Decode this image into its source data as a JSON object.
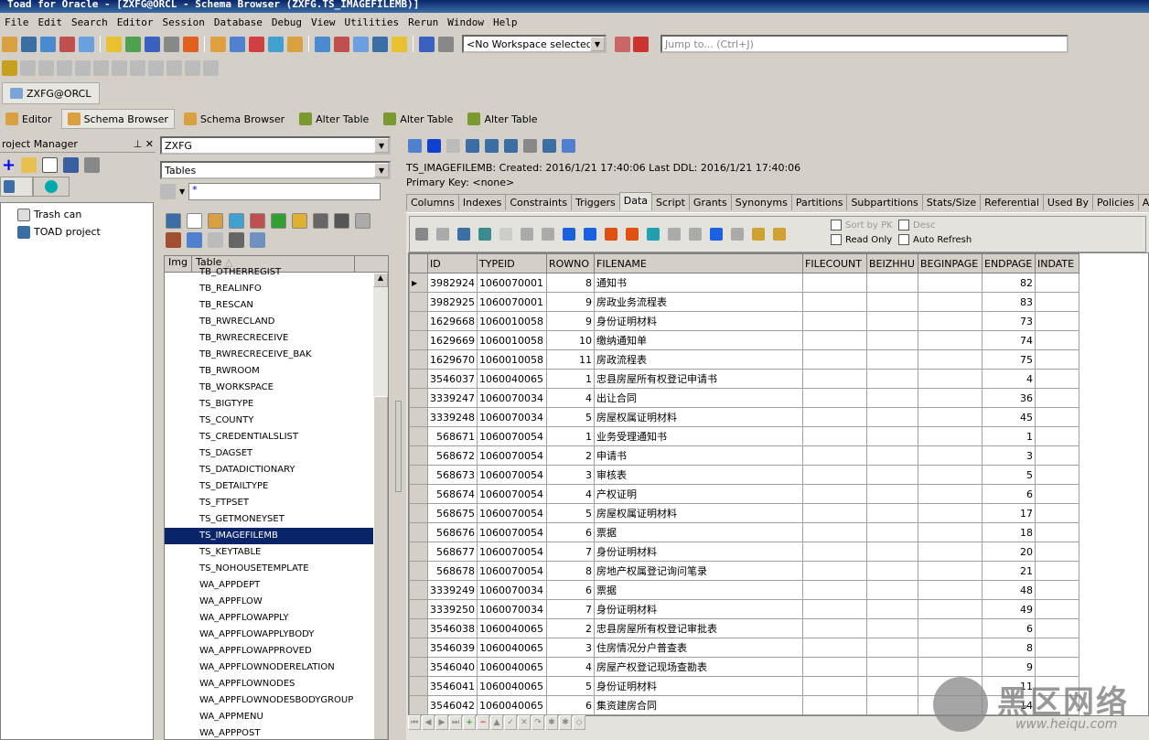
{
  "window": {
    "title": "Toad for Oracle - [ZXFG@ORCL - Schema Browser (ZXFG.TS_IMAGEFILEMB)]"
  },
  "menu": [
    "File",
    "Edit",
    "Search",
    "Editor",
    "Session",
    "Database",
    "Debug",
    "View",
    "Utilities",
    "Rerun",
    "Window",
    "Help"
  ],
  "toolbar": {
    "workspace": "<No Workspace selected>",
    "jump_placeholder": "Jump to... (Ctrl+J)"
  },
  "connection_tab": "ZXFG@ORCL",
  "window_tabs": [
    "Editor",
    "Schema Browser",
    "Schema Browser",
    "Alter Table",
    "Alter Table",
    "Alter Table"
  ],
  "project_manager": {
    "title": "roject Manager",
    "tree": [
      "Trash can",
      "TOAD project"
    ]
  },
  "schema": {
    "owner": "ZXFG",
    "object_type": "Tables",
    "filter": "*",
    "list_headers": [
      "Img",
      "Table"
    ],
    "tables": [
      "TB_OTHERREGIST",
      "TB_REALINFO",
      "TB_RESCAN",
      "TB_RWRECLAND",
      "TB_RWRECRECEIVE",
      "TB_RWRECRECEIVE_BAK",
      "TB_RWROOM",
      "TB_WORKSPACE",
      "TS_BIGTYPE",
      "TS_COUNTY",
      "TS_CREDENTIALSLIST",
      "TS_DAGSET",
      "TS_DATADICTIONARY",
      "TS_DETAILTYPE",
      "TS_FTPSET",
      "TS_GETMONEYSET",
      "TS_IMAGEFILEMB",
      "TS_KEYTABLE",
      "TS_NOHOUSETEMPLATE",
      "WA_APPDEPT",
      "WA_APPFLOW",
      "WA_APPFLOWAPPLY",
      "WA_APPFLOWAPPLYBODY",
      "WA_APPFLOWAPPROVED",
      "WA_APPFLOWNODERELATION",
      "WA_APPFLOWNODES",
      "WA_APPFLOWNODESBODYGROUP",
      "WA_APPMENU",
      "WA_APPPOST"
    ],
    "selected": "TS_IMAGEFILEMB"
  },
  "detail": {
    "info": "TS_IMAGEFILEMB:  Created: 2016/1/21 17:40:06   Last DDL: 2016/1/21 17:40:06",
    "primary_key": "Primary Key:  <none>",
    "tabs": [
      "Columns",
      "Indexes",
      "Constraints",
      "Triggers",
      "Data",
      "Script",
      "Grants",
      "Synonyms",
      "Partitions",
      "Subpartitions",
      "Stats/Size",
      "Referential",
      "Used By",
      "Policies",
      "Auditing"
    ],
    "active_tab": "Data",
    "options": {
      "sort_by_pk": "Sort by PK",
      "desc": "Desc",
      "read_only": "Read Only",
      "auto_refresh": "Auto Refresh"
    }
  },
  "grid": {
    "columns": [
      "ID",
      "TYPEID",
      "ROWNO",
      "FILENAME",
      "FILECOUNT",
      "BEIZHHU",
      "BEGINPAGE",
      "ENDPAGE",
      "INDATE"
    ],
    "rows": [
      [
        "3982924",
        "1060070001",
        "8",
        "通知书",
        "",
        "",
        "",
        "82",
        ""
      ],
      [
        "3982925",
        "1060070001",
        "9",
        "房政业务流程表",
        "",
        "",
        "",
        "83",
        ""
      ],
      [
        "1629668",
        "1060010058",
        "9",
        "身份证明材料",
        "",
        "",
        "",
        "73",
        ""
      ],
      [
        "1629669",
        "1060010058",
        "10",
        "缴纳通知单",
        "",
        "",
        "",
        "74",
        ""
      ],
      [
        "1629670",
        "1060010058",
        "11",
        "房政流程表",
        "",
        "",
        "",
        "75",
        ""
      ],
      [
        "3546037",
        "1060040065",
        "1",
        "忠县房屋所有权登记申请书",
        "",
        "",
        "",
        "4",
        ""
      ],
      [
        "3339247",
        "1060070034",
        "4",
        "出让合同",
        "",
        "",
        "",
        "36",
        ""
      ],
      [
        "3339248",
        "1060070034",
        "5",
        "房屋权属证明材料",
        "",
        "",
        "",
        "45",
        ""
      ],
      [
        "568671",
        "1060070054",
        "1",
        "业务受理通知书",
        "",
        "",
        "",
        "1",
        ""
      ],
      [
        "568672",
        "1060070054",
        "2",
        "申请书",
        "",
        "",
        "",
        "3",
        ""
      ],
      [
        "568673",
        "1060070054",
        "3",
        "审核表",
        "",
        "",
        "",
        "5",
        ""
      ],
      [
        "568674",
        "1060070054",
        "4",
        "产权证明",
        "",
        "",
        "",
        "6",
        ""
      ],
      [
        "568675",
        "1060070054",
        "5",
        "房屋权属证明材料",
        "",
        "",
        "",
        "17",
        ""
      ],
      [
        "568676",
        "1060070054",
        "6",
        "票据",
        "",
        "",
        "",
        "18",
        ""
      ],
      [
        "568677",
        "1060070054",
        "7",
        "身份证明材料",
        "",
        "",
        "",
        "20",
        ""
      ],
      [
        "568678",
        "1060070054",
        "8",
        "房地产权属登记询问笔录",
        "",
        "",
        "",
        "21",
        ""
      ],
      [
        "3339249",
        "1060070034",
        "6",
        "票据",
        "",
        "",
        "",
        "48",
        ""
      ],
      [
        "3339250",
        "1060070034",
        "7",
        "身份证明材料",
        "",
        "",
        "",
        "49",
        ""
      ],
      [
        "3546038",
        "1060040065",
        "2",
        "忠县房屋所有权登记审批表",
        "",
        "",
        "",
        "6",
        ""
      ],
      [
        "3546039",
        "1060040065",
        "3",
        "住房情况分户普查表",
        "",
        "",
        "",
        "8",
        ""
      ],
      [
        "3546040",
        "1060040065",
        "4",
        "房屋产权登记现场查勘表",
        "",
        "",
        "",
        "9",
        ""
      ],
      [
        "3546041",
        "1060040065",
        "5",
        "身份证明材料",
        "",
        "",
        "",
        "11",
        ""
      ],
      [
        "3546042",
        "1060040065",
        "6",
        "集资建房合同",
        "",
        "",
        "",
        "14",
        ""
      ]
    ]
  },
  "watermark": {
    "text": "黑区网络",
    "url": "www.heiqu.com"
  }
}
